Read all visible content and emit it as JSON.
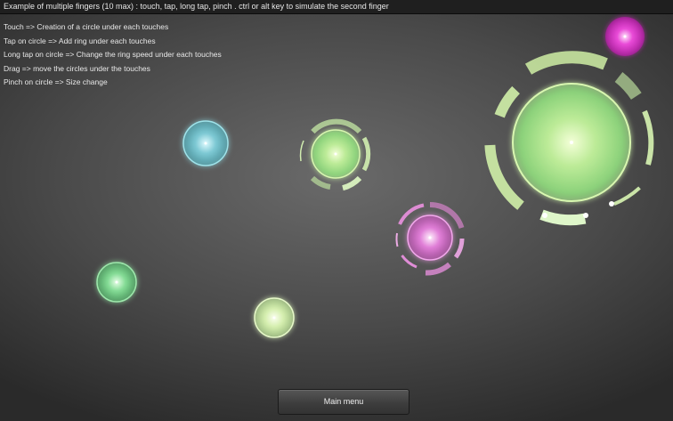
{
  "header": {
    "title": "Example of multiple fingers (10 max) :  touch, tap, long tap, pinch . ctrl or alt key to simulate the second finger"
  },
  "instructions": [
    "Touch => Creation of a circle under each touches",
    "Tap on circle => Add ring under each touches",
    "Long tap on circle => Change the ring speed under each touches",
    "Drag => move the circles under the touches",
    "Pinch on circle => Size change"
  ],
  "colors": {
    "green": "#c8f5a8",
    "green_glow": "#7ee07a",
    "cyan": "#7fd4dc",
    "magenta": "#f03cdc",
    "pink": "#ee86e4",
    "pale_green": "#dcf5b8",
    "mint": "#7ee09a"
  },
  "buttons": {
    "main_menu": "Main menu"
  }
}
